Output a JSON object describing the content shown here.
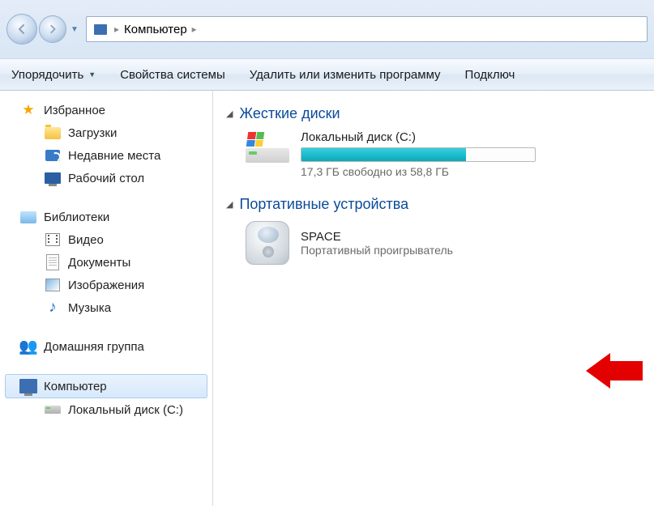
{
  "address": {
    "root": "Компьютер"
  },
  "toolbar": {
    "organize": "Упорядочить",
    "system_props": "Свойства системы",
    "uninstall": "Удалить или изменить программу",
    "connect": "Подключ"
  },
  "sidebar": {
    "favorites": {
      "label": "Избранное",
      "items": [
        {
          "label": "Загрузки"
        },
        {
          "label": "Недавние места"
        },
        {
          "label": "Рабочий стол"
        }
      ]
    },
    "libraries": {
      "label": "Библиотеки",
      "items": [
        {
          "label": "Видео"
        },
        {
          "label": "Документы"
        },
        {
          "label": "Изображения"
        },
        {
          "label": "Музыка"
        }
      ]
    },
    "homegroup": "Домашняя группа",
    "computer": {
      "label": "Компьютер",
      "items": [
        {
          "label": "Локальный диск (C:)"
        }
      ]
    }
  },
  "content": {
    "hard_drives_header": "Жесткие диски",
    "portable_header": "Портативные устройства",
    "local_disk": {
      "name": "Локальный диск (C:)",
      "free_text": "17,3 ГБ свободно из 58,8 ГБ",
      "used_percent": 70.6
    },
    "device": {
      "name": "SPACE",
      "type": "Портативный проигрыватель"
    }
  }
}
